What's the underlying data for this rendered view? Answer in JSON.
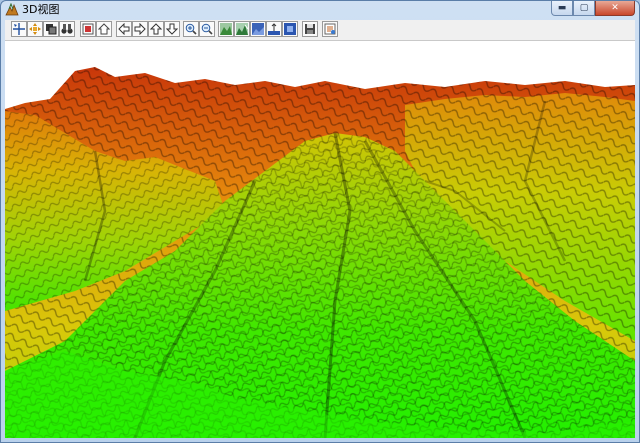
{
  "window": {
    "title": "3D视图",
    "icon": "app-icon"
  },
  "caption_buttons": [
    {
      "name": "minimize-button",
      "glyph": "▬"
    },
    {
      "name": "maximize-button",
      "glyph": "▢"
    },
    {
      "name": "close-button",
      "glyph": "✕"
    }
  ],
  "toolbar": [
    {
      "name": "select-tool-button",
      "icon": "arrow-cross-icon"
    },
    {
      "name": "pan-tool-button",
      "icon": "move-icon"
    },
    {
      "name": "layer-tool-button",
      "icon": "layer-icon"
    },
    {
      "name": "fly-tool-button",
      "icon": "binoculars-icon"
    },
    {
      "name": "full-extent-button",
      "icon": "full-extent-icon"
    },
    {
      "name": "home-view-button",
      "icon": "home-icon"
    },
    {
      "name": "move-left-button",
      "icon": "arrow-left-icon"
    },
    {
      "name": "move-right-button",
      "icon": "arrow-right-icon"
    },
    {
      "name": "move-up-button",
      "icon": "arrow-up-icon"
    },
    {
      "name": "move-down-button",
      "icon": "arrow-down-icon"
    },
    {
      "name": "zoom-in-button",
      "icon": "zoom-in-icon"
    },
    {
      "name": "zoom-out-button",
      "icon": "zoom-out-icon"
    },
    {
      "name": "terrain-render-button",
      "icon": "terrain-icon"
    },
    {
      "name": "terrain-shade-button",
      "icon": "terrain-shade-icon"
    },
    {
      "name": "terrain-texture-button",
      "icon": "terrain-texture-icon"
    },
    {
      "name": "elevation-button",
      "icon": "elevation-icon"
    },
    {
      "name": "terrain-settings-button",
      "icon": "terrain-settings-icon"
    },
    {
      "name": "save-button",
      "icon": "save-icon"
    },
    {
      "name": "properties-button",
      "icon": "properties-icon"
    }
  ],
  "colors": {
    "low": "#2ef000",
    "mid": "#d8e000",
    "high": "#f0a000",
    "peak": "#d23000",
    "sky": "#ffffff"
  }
}
